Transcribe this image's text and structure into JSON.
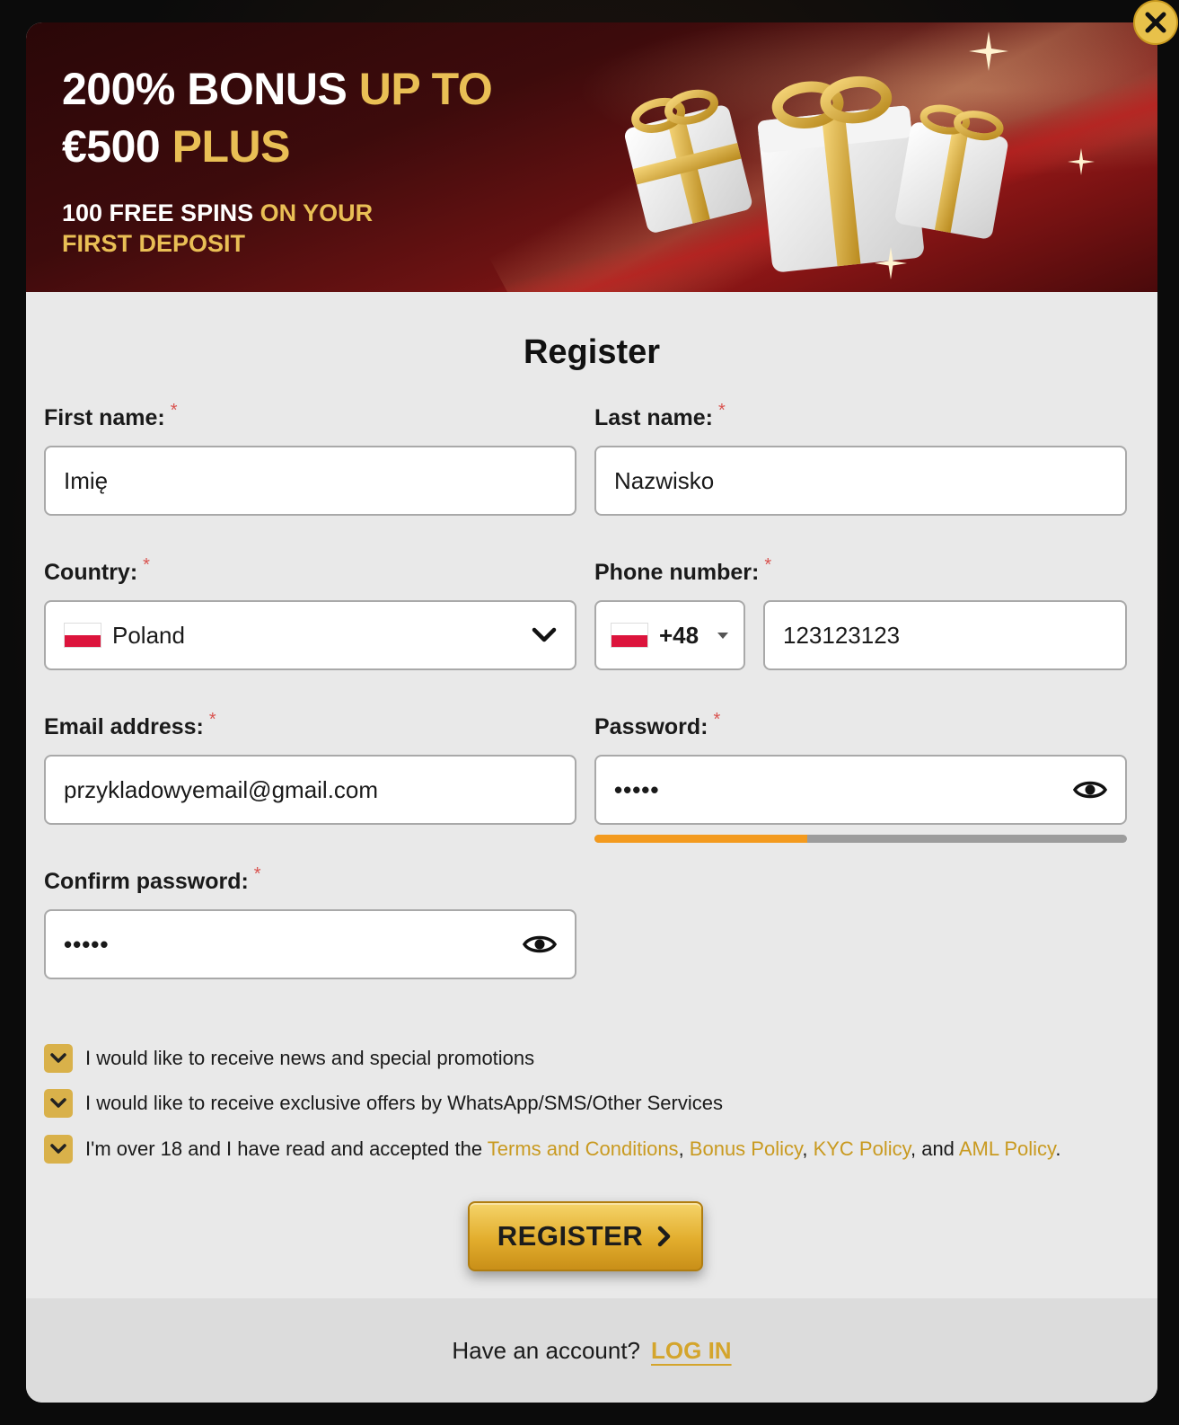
{
  "banner": {
    "line1_white": "200% BONUS ",
    "line1_gold": "UP TO",
    "line2_white": "€500 ",
    "line2_gold": "PLUS",
    "sub_white": "100 FREE SPINS ",
    "sub_gold": "ON YOUR FIRST DEPOSIT"
  },
  "form": {
    "title": "Register",
    "required_mark": "*",
    "first_name": {
      "label": "First name:",
      "value": "Imię"
    },
    "last_name": {
      "label": "Last name:",
      "value": "Nazwisko"
    },
    "country": {
      "label": "Country:",
      "value": "Poland"
    },
    "phone": {
      "label": "Phone number:",
      "code": "+48",
      "value": "123123123"
    },
    "email": {
      "label": "Email address:",
      "value": "przykladowyemail@gmail.com"
    },
    "password": {
      "label": "Password:",
      "value": "•••••",
      "strength": 0.4
    },
    "confirm_password": {
      "label": "Confirm password:",
      "value": "•••••"
    }
  },
  "consents": {
    "news": "I would like to receive news and special promotions",
    "offers": "I would like to receive exclusive offers by WhatsApp/SMS/Other Services",
    "terms_prefix": "I'm over 18 and I have read and accepted the ",
    "terms_link": "Terms and Conditions",
    "sep1": ", ",
    "bonus_link": "Bonus Policy",
    "sep2": ", ",
    "kyc_link": "KYC Policy",
    "sep3": ", and ",
    "aml_link": "AML Policy",
    "end": "."
  },
  "actions": {
    "register_label": "REGISTER",
    "have_account": "Have an account?",
    "login_label": "LOG IN"
  },
  "colors": {
    "gold": "#e9bf55",
    "accent": "#d4a52c",
    "required": "#d9534f",
    "strength": "#f39a1e"
  }
}
